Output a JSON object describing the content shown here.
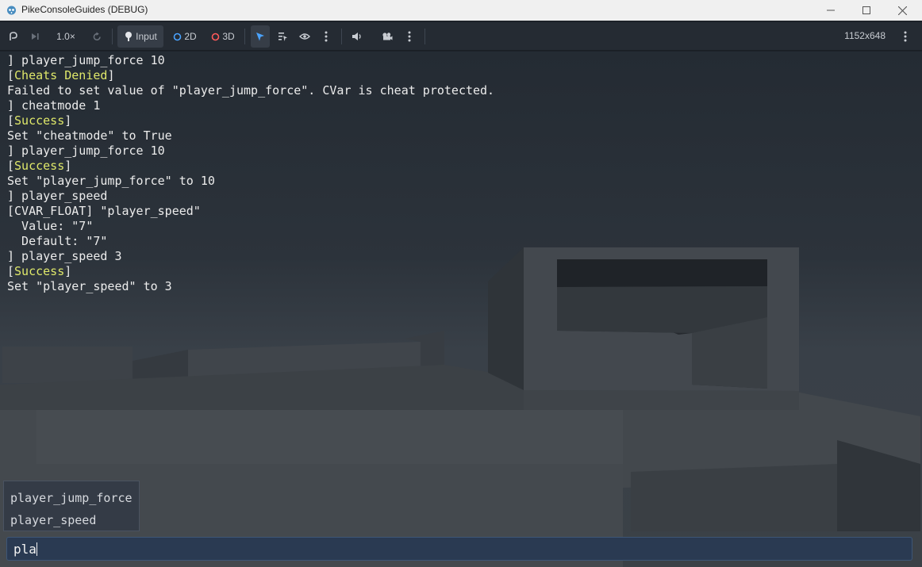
{
  "window": {
    "title": "PikeConsoleGuides (DEBUG)"
  },
  "toolbar": {
    "speed": "1.0×",
    "input_label": "Input",
    "mode_2d_label": "2D",
    "mode_3d_label": "3D",
    "viewport_size": "1152x648"
  },
  "console": {
    "lines": [
      {
        "prefix": "] player_jump_force 10",
        "tag": "",
        "suffix": ""
      },
      {
        "prefix": "[",
        "tag": "Cheats Denied",
        "suffix": "]"
      },
      {
        "prefix": "Failed to set value of \"player_jump_force\". CVar is cheat protected.",
        "tag": "",
        "suffix": ""
      },
      {
        "prefix": "] cheatmode 1",
        "tag": "",
        "suffix": ""
      },
      {
        "prefix": "[",
        "tag": "Success",
        "suffix": "]"
      },
      {
        "prefix": "Set \"cheatmode\" to True",
        "tag": "",
        "suffix": ""
      },
      {
        "prefix": "] player_jump_force 10",
        "tag": "",
        "suffix": ""
      },
      {
        "prefix": "[",
        "tag": "Success",
        "suffix": "]"
      },
      {
        "prefix": "Set \"player_jump_force\" to 10",
        "tag": "",
        "suffix": ""
      },
      {
        "prefix": "] player_speed",
        "tag": "",
        "suffix": ""
      },
      {
        "prefix": "[CVAR_FLOAT] \"player_speed\"",
        "tag": "",
        "suffix": ""
      },
      {
        "prefix": "  Value: \"7\"",
        "tag": "",
        "suffix": ""
      },
      {
        "prefix": "  Default: \"7\"",
        "tag": "",
        "suffix": ""
      },
      {
        "prefix": "] player_speed 3",
        "tag": "",
        "suffix": ""
      },
      {
        "prefix": "[",
        "tag": "Success",
        "suffix": "]"
      },
      {
        "prefix": "Set \"player_speed\" to 3",
        "tag": "",
        "suffix": ""
      }
    ],
    "autocomplete": [
      "player_jump_force",
      "player_speed"
    ],
    "input_value": "pla"
  },
  "colors": {
    "tag_highlight": "#dfe86a",
    "input_bg": "#2a3a52",
    "accent_blue": "#4aa3ff",
    "mode_3d_red": "#ff5a5a"
  }
}
